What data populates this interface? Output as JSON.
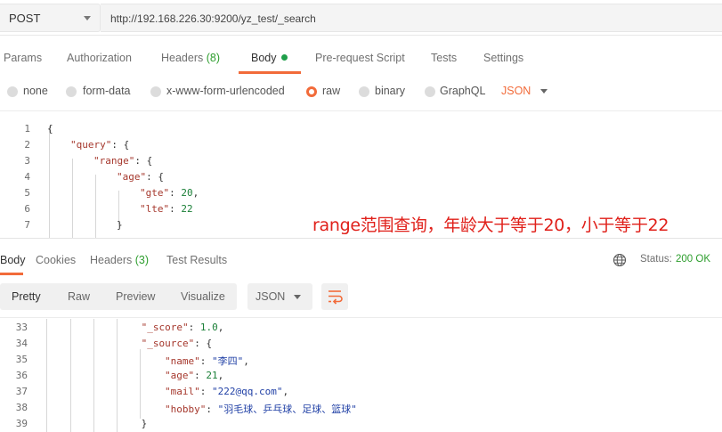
{
  "request": {
    "method": "POST",
    "url": "http://192.168.226.30:9200/yz_test/_search"
  },
  "request_tabs": {
    "params": "Params",
    "authorization": "Authorization",
    "headers": "Headers",
    "headers_count": "(8)",
    "body": "Body",
    "pre_request": "Pre-request Script",
    "tests": "Tests",
    "settings": "Settings"
  },
  "body_types": {
    "none": "none",
    "form_data": "form-data",
    "urlencoded": "x-www-form-urlencoded",
    "raw": "raw",
    "binary": "binary",
    "graphql": "GraphQL",
    "language": "JSON",
    "selected": "raw"
  },
  "request_body": {
    "lines": [
      {
        "n": "1",
        "t": "{"
      },
      {
        "n": "2",
        "k": "\"query\"",
        "t": ": {"
      },
      {
        "n": "3",
        "k": "\"range\"",
        "t": ": {"
      },
      {
        "n": "4",
        "k": "\"age\"",
        "t": ": {"
      },
      {
        "n": "5",
        "k": "\"gte\"",
        "v": "20",
        "t": ","
      },
      {
        "n": "6",
        "k": "\"lte\"",
        "v": "22"
      },
      {
        "n": "7",
        "t": "}"
      }
    ]
  },
  "annotation": "range范围查询，年龄大于等于20，小于等于22",
  "response_tabs": {
    "body": "Body",
    "cookies": "Cookies",
    "headers": "Headers",
    "headers_count": "(3)",
    "test_results": "Test Results",
    "status_label": "Status:",
    "status_value": "200 OK"
  },
  "response_toolbar": {
    "pretty": "Pretty",
    "raw": "Raw",
    "preview": "Preview",
    "visualize": "Visualize",
    "format": "JSON"
  },
  "response_body": {
    "lines": [
      {
        "n": "33",
        "k": "\"_score\"",
        "v": "1.0",
        "t": ","
      },
      {
        "n": "34",
        "k": "\"_source\"",
        "t": ": {"
      },
      {
        "n": "35",
        "k": "\"name\"",
        "s": "\"李四\"",
        "t": ","
      },
      {
        "n": "36",
        "k": "\"age\"",
        "v": "21",
        "t": ","
      },
      {
        "n": "37",
        "k": "\"mail\"",
        "s": "\"222@qq.com\"",
        "t": ","
      },
      {
        "n": "38",
        "k": "\"hobby\"",
        "s": "\"羽毛球、乒乓球、足球、篮球\""
      },
      {
        "n": "39",
        "t": "}"
      }
    ]
  },
  "colors": {
    "accent": "#f26b3a",
    "status_ok": "#2e9e2e",
    "annotation": "#e0201a"
  }
}
